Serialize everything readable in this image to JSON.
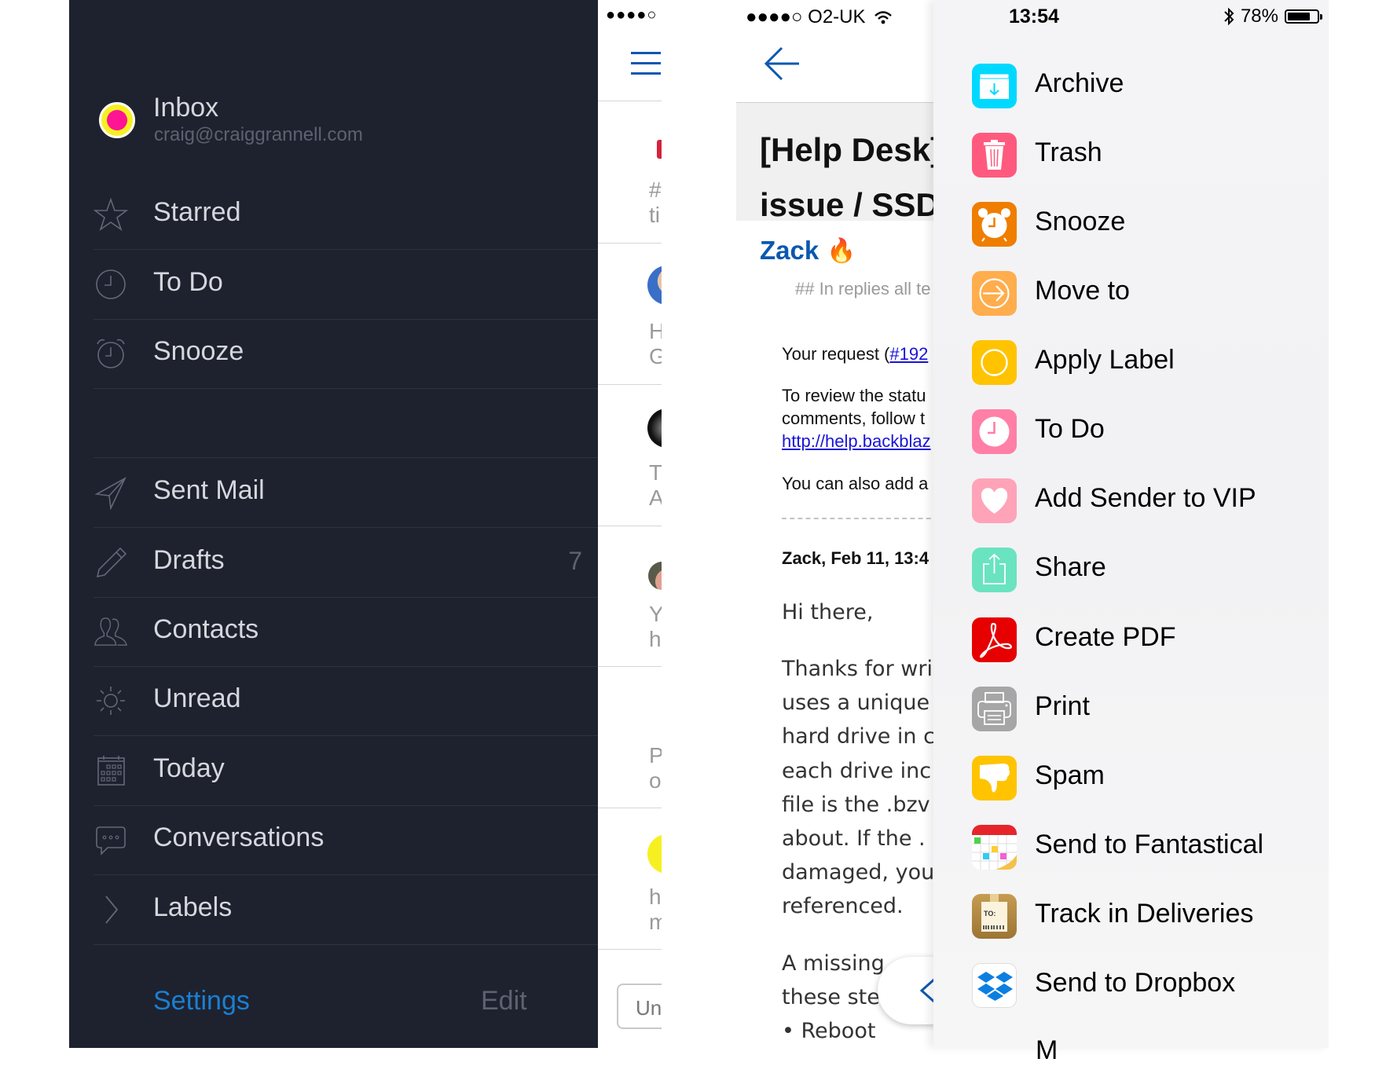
{
  "sidebar": {
    "account": {
      "title": "Inbox",
      "email": "craig@craiggrannell.com"
    },
    "items": [
      {
        "label": "Starred",
        "icon": "star-icon",
        "count": ""
      },
      {
        "label": "To Do",
        "icon": "clock-icon",
        "count": ""
      },
      {
        "label": "Snooze",
        "icon": "alarm-clock-icon",
        "count": ""
      },
      {
        "label": "Sent Mail",
        "icon": "paper-plane-icon",
        "count": ""
      },
      {
        "label": "Drafts",
        "icon": "pencil-icon",
        "count": "7"
      },
      {
        "label": "Contacts",
        "icon": "contacts-icon",
        "count": ""
      },
      {
        "label": "Unread",
        "icon": "sun-icon",
        "count": ""
      },
      {
        "label": "Today",
        "icon": "calendar-icon",
        "count": ""
      },
      {
        "label": "Conversations",
        "icon": "speech-bubble-icon",
        "count": ""
      },
      {
        "label": "Labels",
        "icon": "chevron-right-icon",
        "count": ""
      }
    ],
    "footer": {
      "settings_label": "Settings",
      "edit_label": "Edit"
    },
    "colors": {
      "background": "#1e222e",
      "accent": "#1a7fd4"
    }
  },
  "mail_list": {
    "signal": "●●●●○",
    "menu_icon": "hamburger-menu-icon",
    "snippets": [
      {
        "line1": "#",
        "line2": "ti"
      },
      {
        "line1": "H",
        "line2": "G"
      },
      {
        "line1": "T",
        "line2": "A"
      },
      {
        "line1": "Y",
        "line2": "h"
      },
      {
        "line1": "P",
        "line2": "o"
      },
      {
        "line1": "h",
        "line2": "m"
      }
    ],
    "unread_button": "Un"
  },
  "email": {
    "status": {
      "signal": "●●●●○",
      "carrier": "O2-UK"
    },
    "back_icon": "back-arrow-icon",
    "subject_line1": "[Help Desk]",
    "subject_line2": "issue / SSD",
    "sender": "Zack",
    "reply_note": "## In replies all te",
    "body": {
      "request_prefix": "Your request (",
      "request_link": "#192",
      "review_line1": "To review the statu",
      "review_line2": "comments, follow t",
      "review_link": "http://help.backblaz",
      "add_line": "You can also add a",
      "meta_line": "Zack, Feb 11, 13:4",
      "greeting": "Hi there,",
      "para": [
        "Thanks for wri",
        "uses a unique",
        "hard drive in c",
        "each drive inc",
        "file is the .bzv",
        "about. If the .",
        "damaged, you",
        "referenced."
      ],
      "para2": [
        "A missing",
        "these ste",
        "• Reboot"
      ]
    }
  },
  "action_sheet": {
    "status": {
      "time": "13:54",
      "battery": "78%",
      "battery_fraction": 0.78
    },
    "actions": [
      {
        "label": "Archive",
        "icon": "archive-box-icon",
        "color": "#00d9ff"
      },
      {
        "label": "Trash",
        "icon": "trash-can-icon",
        "color": "#ff5a7e"
      },
      {
        "label": "Snooze",
        "icon": "alarm-clock-icon",
        "color": "#ef7d00"
      },
      {
        "label": "Move to",
        "icon": "arrow-circle-icon",
        "color": "#ffad4d"
      },
      {
        "label": "Apply Label",
        "icon": "circle-icon",
        "color": "#ffc300"
      },
      {
        "label": "To Do",
        "icon": "clock-icon",
        "color": "#ff7fa7"
      },
      {
        "label": "Add Sender to VIP",
        "icon": "heart-icon",
        "color": "#ffa3b8"
      },
      {
        "label": "Share",
        "icon": "share-icon",
        "color": "#6ae3c0"
      },
      {
        "label": "Create PDF",
        "icon": "acrobat-icon",
        "color": "#e60000"
      },
      {
        "label": "Print",
        "icon": "printer-icon",
        "color": "#a6a6a6"
      },
      {
        "label": "Spam",
        "icon": "thumbs-down-icon",
        "color": "#ffc300"
      },
      {
        "label": "Send to Fantastical",
        "icon": "fantastical-calendar-icon",
        "color": "#e6252b"
      },
      {
        "label": "Track in Deliveries",
        "icon": "deliveries-package-icon",
        "color": "#c69c52"
      },
      {
        "label": "Send to Dropbox",
        "icon": "dropbox-icon",
        "color": "#0b7fe0"
      }
    ]
  }
}
